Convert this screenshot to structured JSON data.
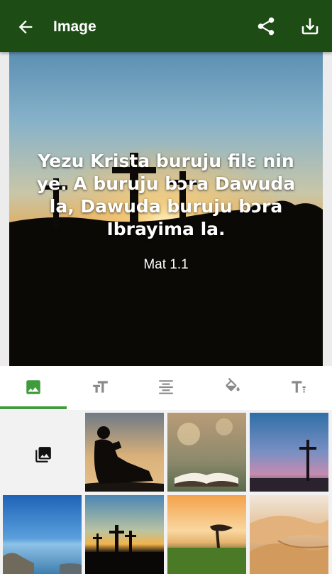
{
  "appbar": {
    "title": "Image",
    "back_icon": "arrow-back-icon",
    "share_icon": "share-icon",
    "download_icon": "download-icon",
    "background": "#1d4d14"
  },
  "preview": {
    "verse_text": "Yezu Krista buruju filɛ nin ye. A buruju bɔra Dawuda la, Dawuda buruju bɔra Ibrayima la.",
    "reference": "Mat 1.1"
  },
  "tabs": [
    {
      "name": "background-image",
      "icon": "image-icon",
      "selected": true
    },
    {
      "name": "text-size",
      "icon": "text-size-icon",
      "selected": false
    },
    {
      "name": "alignment",
      "icon": "align-center-icon",
      "selected": false
    },
    {
      "name": "color",
      "icon": "paint-bucket-icon",
      "selected": false
    },
    {
      "name": "font",
      "icon": "text-format-icon",
      "selected": false
    }
  ],
  "accent_color": "#3f9b3c",
  "gallery": {
    "picker_icon": "photo-library-icon",
    "images": [
      "boy-reading-silhouette",
      "open-bible",
      "cross-at-dusk",
      "calm-sea",
      "three-crosses-sunset",
      "savanna-tree-sunset",
      "desert-dunes"
    ]
  }
}
